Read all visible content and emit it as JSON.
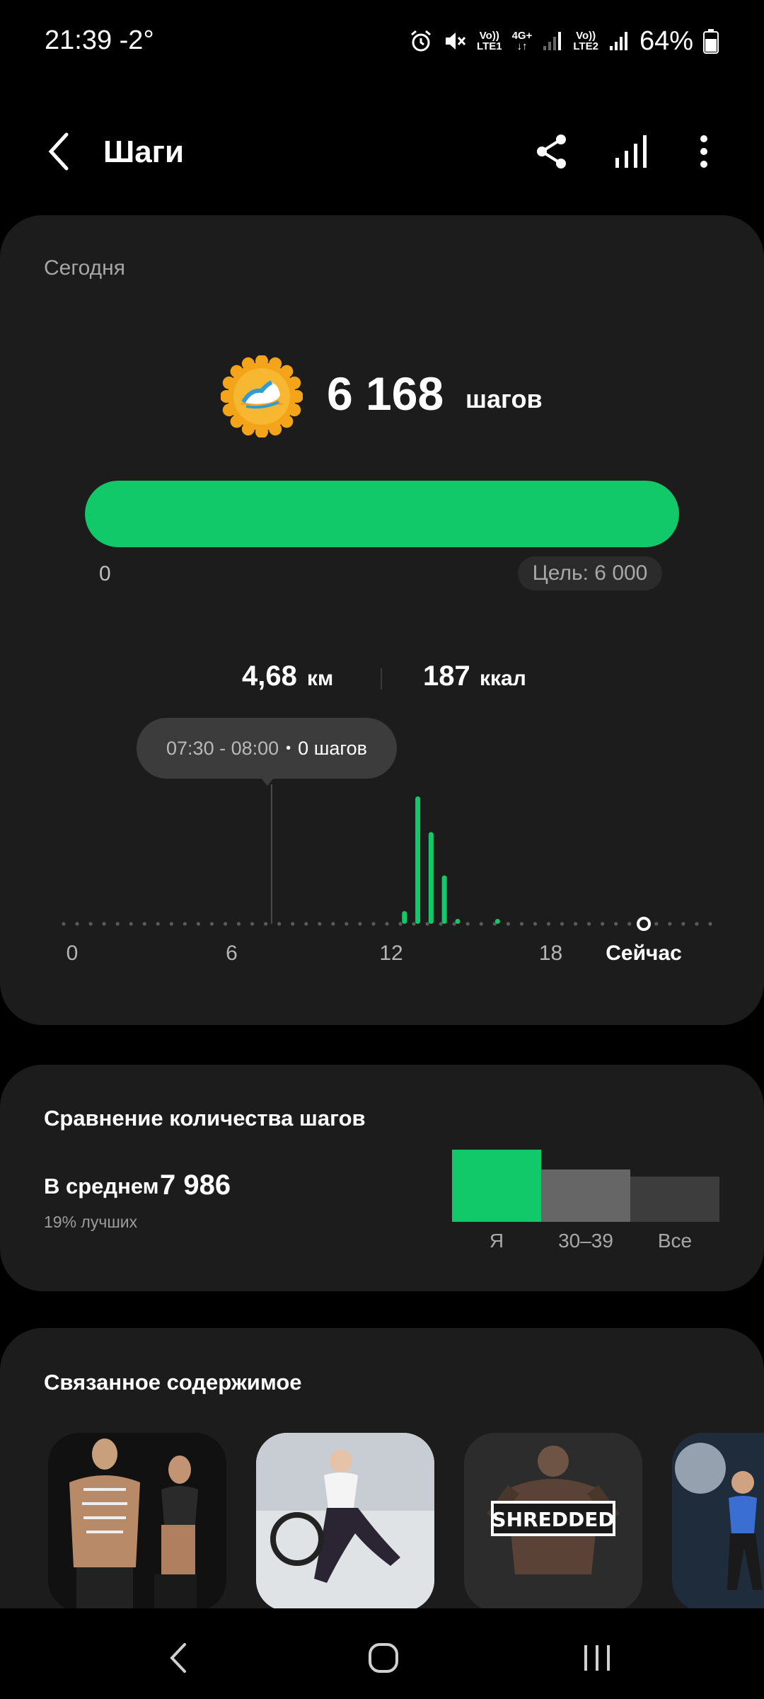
{
  "status_bar": {
    "time": "21:39",
    "temperature": "-2°",
    "net1_top": "Vo))",
    "net1_bottom": "LTE1",
    "net_mid_top": "4G+",
    "net2_top": "Vo))",
    "net2_bottom": "LTE2",
    "battery": "64%"
  },
  "header": {
    "title": "Шаги"
  },
  "today": {
    "label": "Сегодня",
    "steps": "6 168",
    "steps_unit": "шагов",
    "progress_fraction": 1.0,
    "progress_start": "0",
    "goal": "Цель: 6 000",
    "distance": "4,68",
    "distance_unit": "км",
    "calories": "187",
    "calories_unit": "ккал"
  },
  "tooltip": {
    "range": "07:30 - 08:00",
    "count": "0 шагов"
  },
  "chart_data": {
    "type": "bar",
    "xlabel": "",
    "ylabel": "",
    "x_ticks": [
      "0",
      "6",
      "12",
      "18",
      "Сейчас"
    ],
    "x": [
      12.5,
      13.0,
      13.5,
      14.0,
      14.5,
      16.0
    ],
    "values": [
      10,
      100,
      72,
      38,
      2,
      2
    ],
    "selected_x": 7.5,
    "selected_value": 0,
    "now_x": 21.5,
    "xlim": [
      0,
      24
    ],
    "color": "#12c96a"
  },
  "comparison": {
    "title": "Сравнение количества шагов",
    "avg_label": "В среднем",
    "avg_value": "7 986",
    "sub": "19% лучших",
    "bars": [
      {
        "label": "Я",
        "value": 6168,
        "color": "#12c96a"
      },
      {
        "label": "30–39",
        "value": 4500,
        "color": "#666666"
      },
      {
        "label": "Все",
        "value": 3900,
        "color": "#3d3d3d"
      }
    ]
  },
  "related": {
    "title": "Связанное содержимое",
    "thumb3_text": "SHREDDED"
  }
}
